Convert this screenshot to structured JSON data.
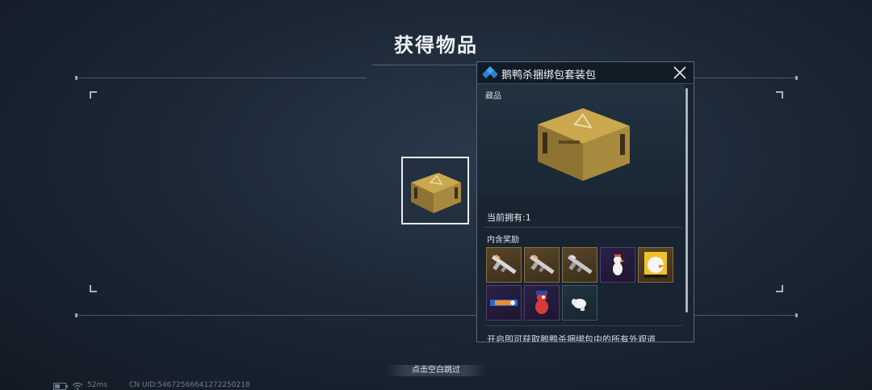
{
  "page": {
    "title": "获得物品"
  },
  "item_preview": {
    "icon": "supply-crate-icon"
  },
  "panel": {
    "title": "鹅鸭杀捆绑包套装包",
    "header_icon": "diamond-icon",
    "category": "藏品",
    "owned": "当前拥有:1",
    "rewards_label": "内含奖励",
    "rewards": [
      {
        "icon": "rifle-skin-icon",
        "rarity": "gold"
      },
      {
        "icon": "rifle-skin-icon",
        "rarity": "gold"
      },
      {
        "icon": "rifle-skin-icon",
        "rarity": "gold"
      },
      {
        "icon": "duck-figure-icon",
        "rarity": "purple"
      },
      {
        "icon": "duck-card-icon",
        "rarity": "gold"
      },
      {
        "icon": "name-banner-icon",
        "rarity": "purple"
      },
      {
        "icon": "red-bird-figure-icon",
        "rarity": "purple"
      },
      {
        "icon": "white-glove-icon",
        "rarity": "teal"
      }
    ],
    "description_partial": "开启即可获取鹅鸭杀捆绑包中的所有外观道"
  },
  "footer": {
    "skip_label": "点击空白跳过",
    "ping": "52ms",
    "uid": "CN UID:5467256664127225021​8"
  },
  "colors": {
    "accent": "#3a8fd8",
    "panel_bg": "#182430",
    "gold_rarity": "#8a6e40",
    "purple_rarity": "#4d3e72"
  }
}
